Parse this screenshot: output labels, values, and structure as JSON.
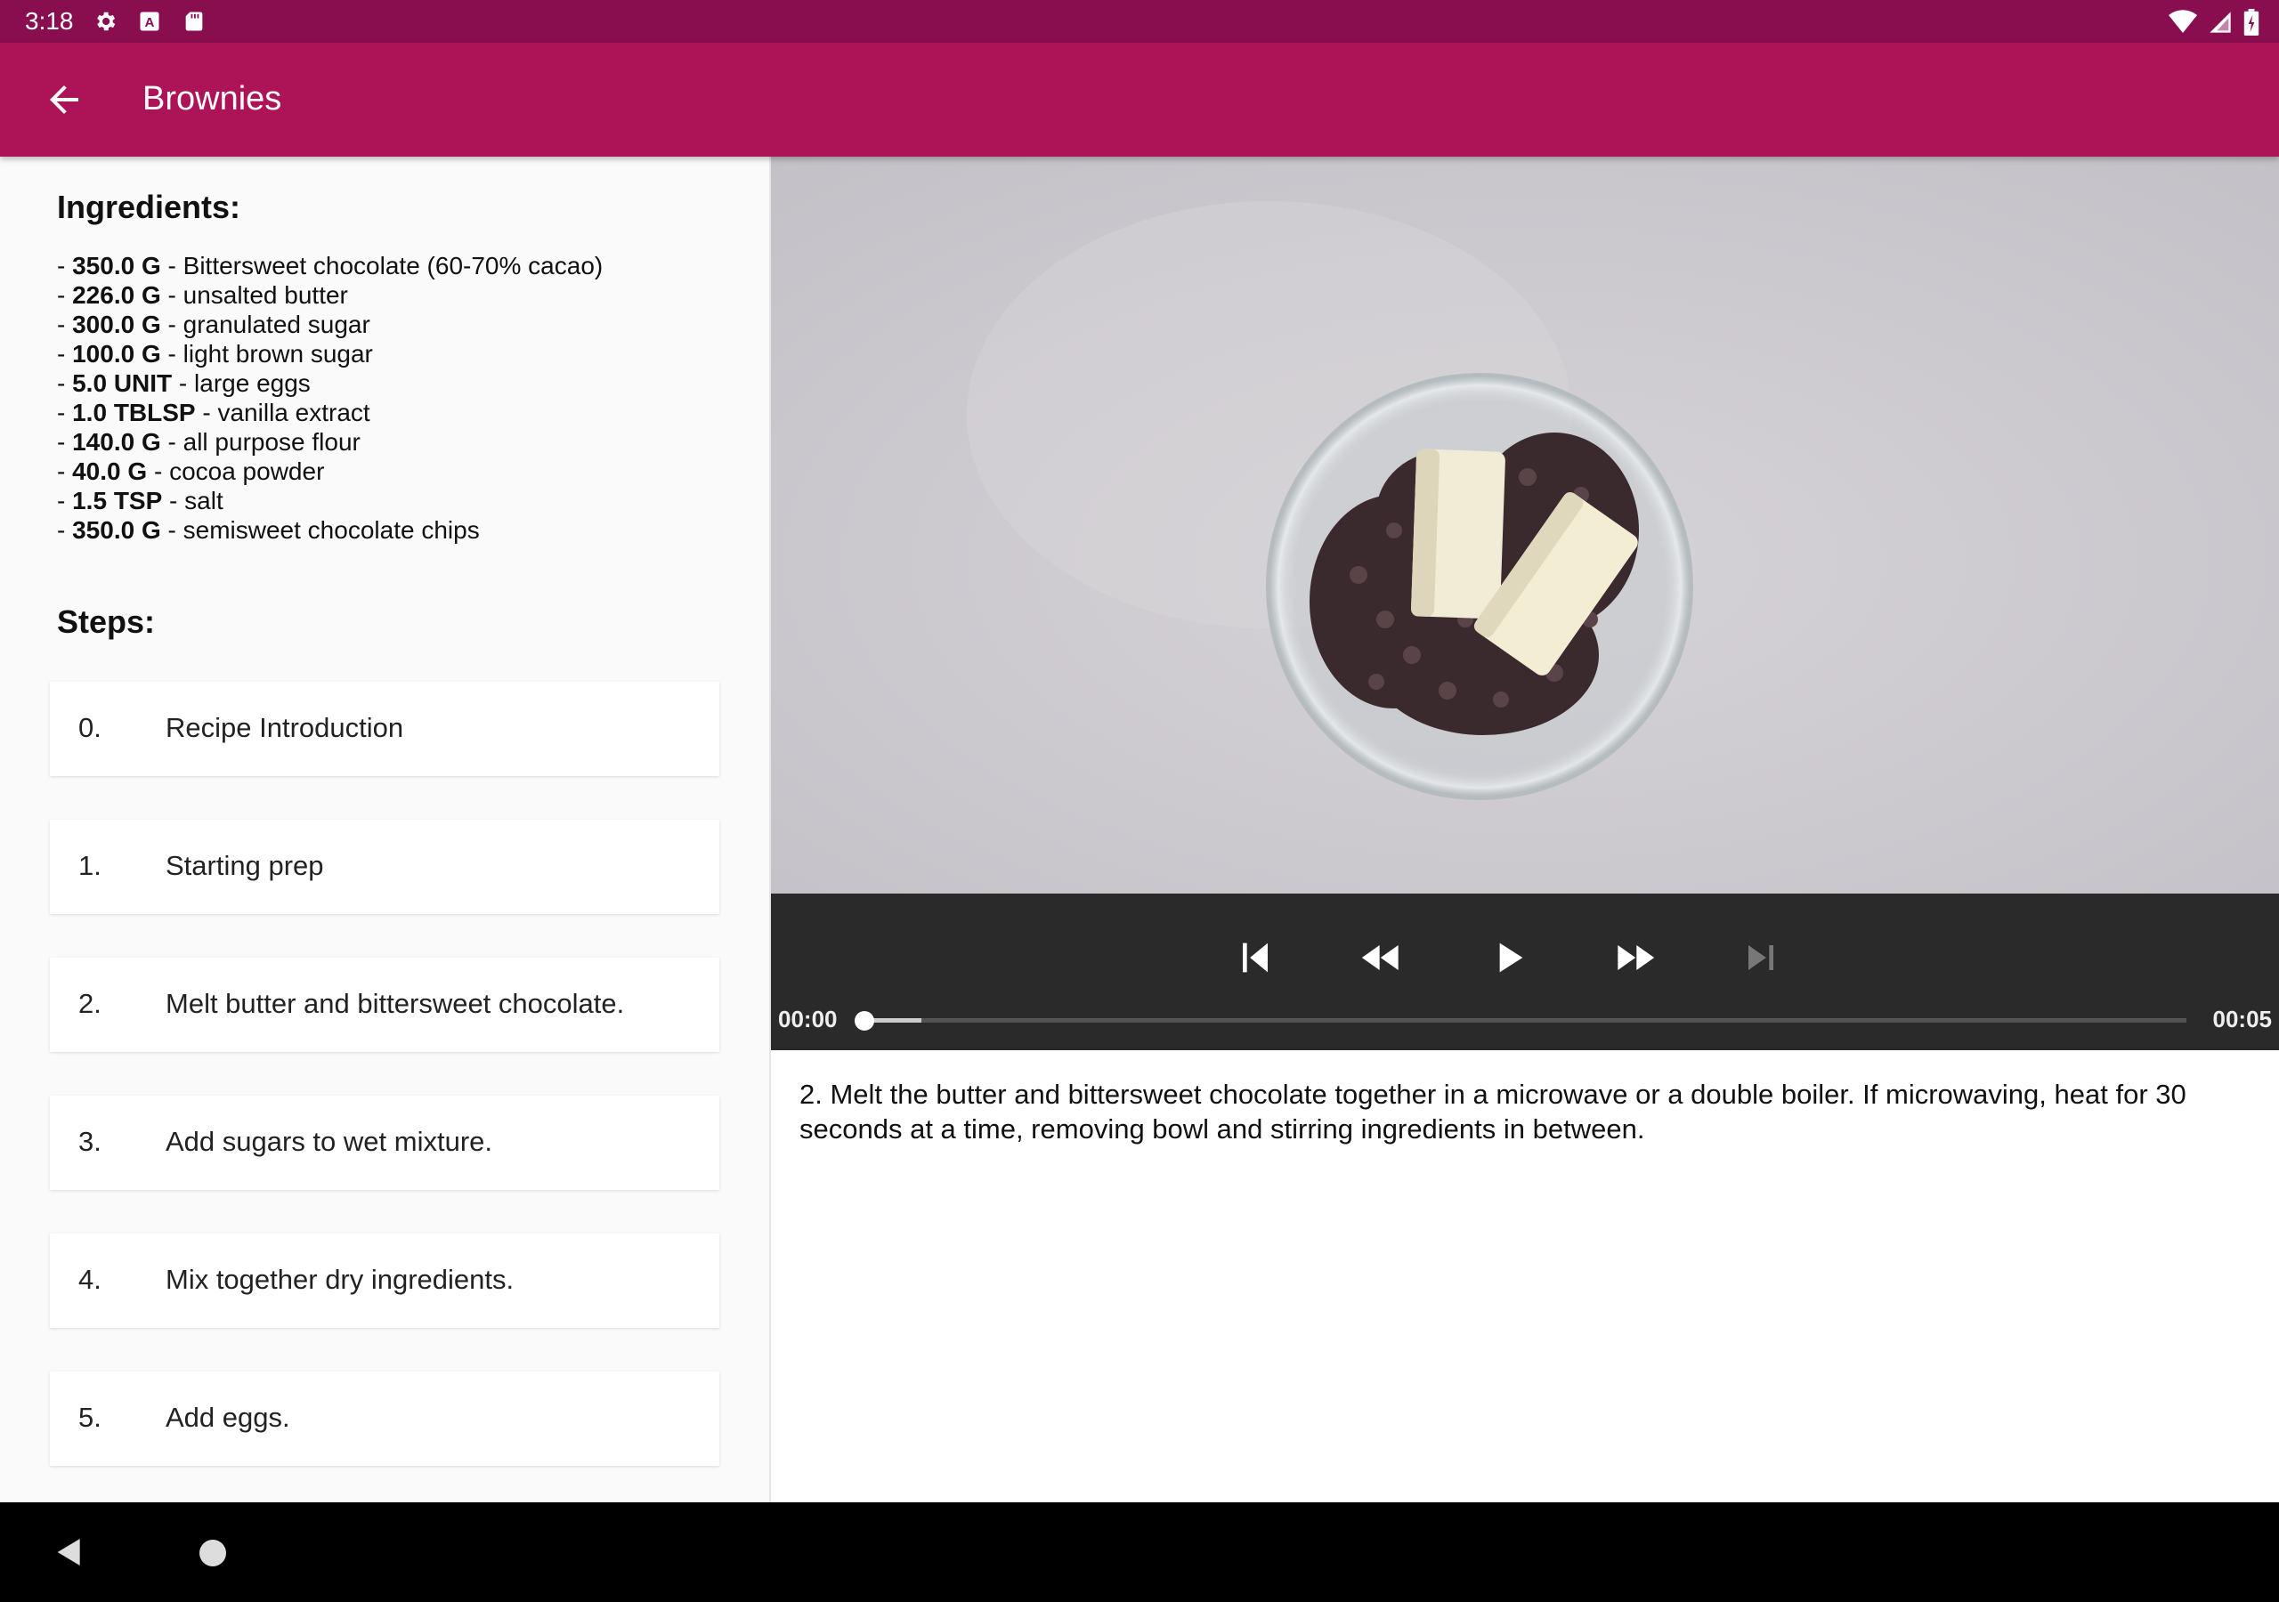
{
  "status_bar": {
    "time": "3:18",
    "icons": [
      "settings-icon",
      "a-badge-icon",
      "sd-card-icon",
      "wifi-icon",
      "signal-icon",
      "battery-icon"
    ]
  },
  "app_bar": {
    "title": "Brownies",
    "back_icon": "arrow-back-icon"
  },
  "ingredients": {
    "title": "Ingredients:",
    "items": [
      {
        "qty": "350.0 G",
        "name": "Bittersweet chocolate (60-70% cacao)"
      },
      {
        "qty": "226.0 G",
        "name": "unsalted butter"
      },
      {
        "qty": "300.0 G",
        "name": "granulated sugar"
      },
      {
        "qty": "100.0 G",
        "name": "light brown sugar"
      },
      {
        "qty": "5.0 UNIT",
        "name": "large eggs"
      },
      {
        "qty": "1.0 TBLSP",
        "name": "vanilla extract"
      },
      {
        "qty": "140.0 G",
        "name": "all purpose flour"
      },
      {
        "qty": "40.0 G",
        "name": "cocoa powder"
      },
      {
        "qty": "1.5 TSP",
        "name": "salt"
      },
      {
        "qty": "350.0 G",
        "name": "semisweet chocolate chips"
      }
    ]
  },
  "steps": {
    "title": "Steps:",
    "items": [
      {
        "num": "0.",
        "label": "Recipe Introduction"
      },
      {
        "num": "1.",
        "label": "Starting prep"
      },
      {
        "num": "2.",
        "label": "Melt butter and bittersweet chocolate."
      },
      {
        "num": "3.",
        "label": "Add sugars to wet mixture."
      },
      {
        "num": "4.",
        "label": "Mix together dry ingredients."
      },
      {
        "num": "5.",
        "label": "Add eggs."
      }
    ]
  },
  "player": {
    "position": "00:00",
    "duration": "00:05",
    "buffered_fraction": 0.045,
    "controls": [
      "skip-previous-icon",
      "rewind-icon",
      "play-icon",
      "fast-forward-icon",
      "skip-next-icon"
    ]
  },
  "description": "2. Melt the butter and bittersweet chocolate together in a microwave or a double boiler. If microwaving, heat for 30 seconds at a time, removing bowl and stirring ingredients in between.",
  "colors": {
    "status_bar": "#880e4f",
    "app_bar": "#ad1457",
    "controls_bg": "#2a2a2a"
  }
}
